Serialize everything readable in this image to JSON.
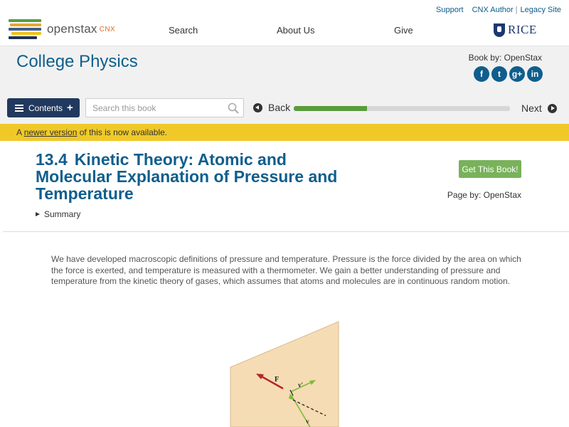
{
  "header": {
    "logo_brand": "openstax",
    "logo_sub": "CNX",
    "util_links": [
      "Support",
      "CNX Author",
      "Legacy Site"
    ],
    "nav": [
      "Search",
      "About Us",
      "Give"
    ],
    "partner": "RICE"
  },
  "book": {
    "title": "College Physics",
    "by": "Book by: OpenStax",
    "social": [
      {
        "icon": "facebook-icon",
        "glyph": "f"
      },
      {
        "icon": "twitter-icon",
        "glyph": "t"
      },
      {
        "icon": "google-plus-icon",
        "glyph": "g+"
      },
      {
        "icon": "linkedin-icon",
        "glyph": "in"
      }
    ]
  },
  "toolbar": {
    "contents_label": "Contents",
    "search_placeholder": "Search this book",
    "back_label": "Back",
    "next_label": "Next",
    "progress_fraction": 0.34
  },
  "notice": {
    "prefix": "A",
    "link": "newer version",
    "suffix": "of this is now available."
  },
  "page": {
    "number": "13.4",
    "title": "Kinetic Theory: Atomic and Molecular Explanation of Pressure and Temperature",
    "get_book": "Get This Book!",
    "page_by": "Page by: OpenStax",
    "summary": "Summary",
    "paragraph": "We have developed macroscopic definitions of pressure and temperature. Pressure is the force divided by the area on which the force is exerted, and temperature is measured with a thermometer. We gain a better understanding of pressure and temperature from the kinetic theory of gases, which assumes that atoms and molecules are in continuous random motion.",
    "figure_labels": {
      "force": "F",
      "v_prime": "v′",
      "v": "v"
    }
  },
  "colors": {
    "brand_blue": "#0f5e8d",
    "nav_dark": "#21395e",
    "progress_green": "#5a9c3c",
    "notice_yellow": "#f0c929",
    "button_green": "#78b25a",
    "force_arrow": "#b3262b",
    "velocity_arrow": "#7cbc3a"
  }
}
